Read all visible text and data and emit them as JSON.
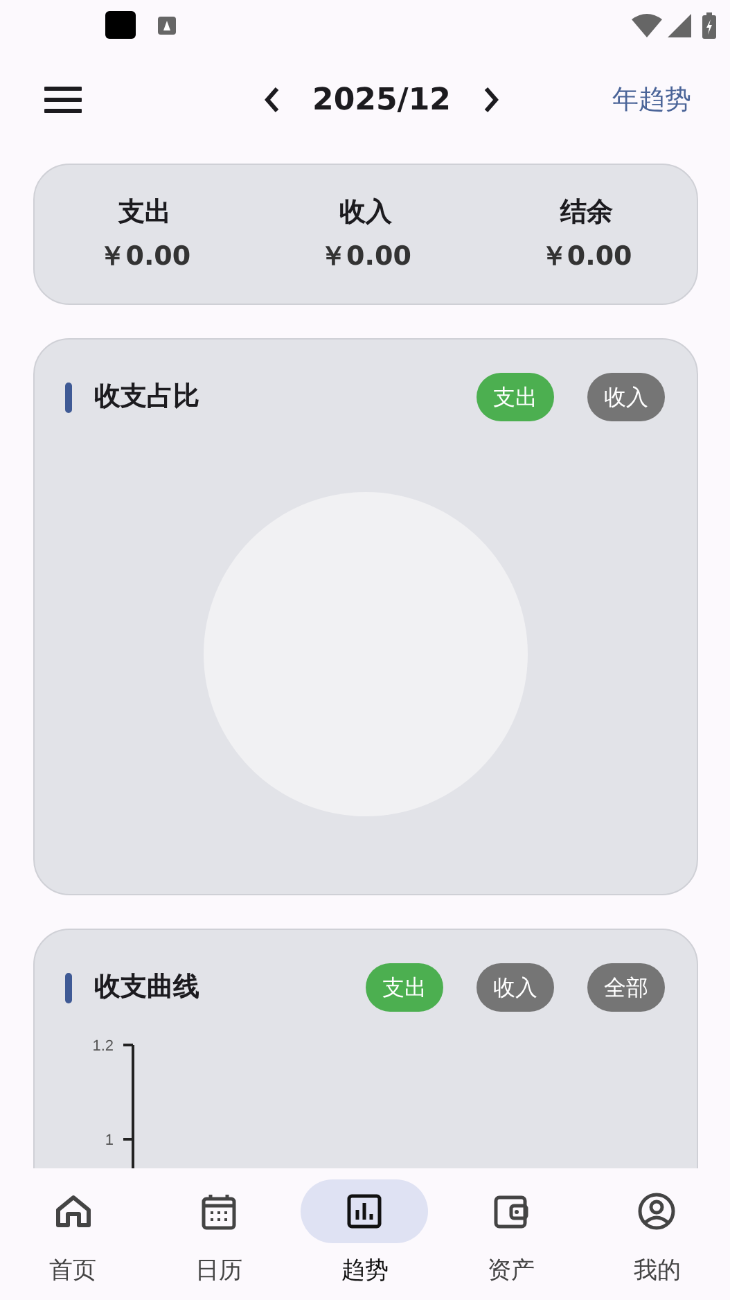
{
  "header": {
    "period": "2025/12",
    "trend_link": "年趋势"
  },
  "summary": [
    {
      "label": "支出",
      "value": "￥0.00"
    },
    {
      "label": "收入",
      "value": "￥0.00"
    },
    {
      "label": "结余",
      "value": "￥0.00"
    }
  ],
  "ratio_panel": {
    "title": "收支占比",
    "toggles": [
      {
        "label": "支出",
        "selected": true
      },
      {
        "label": "收入",
        "selected": false
      }
    ]
  },
  "curve_panel": {
    "title": "收支曲线",
    "toggles": [
      {
        "label": "支出",
        "selected": true
      },
      {
        "label": "收入",
        "selected": false
      },
      {
        "label": "全部",
        "selected": false
      }
    ],
    "y_axis_labels": [
      "1.2",
      "1"
    ]
  },
  "bottom_nav": [
    {
      "label": "首页",
      "selected": false
    },
    {
      "label": "日历",
      "selected": false
    },
    {
      "label": "趋势",
      "selected": true
    },
    {
      "label": "资产",
      "selected": false
    },
    {
      "label": "我的",
      "selected": false
    }
  ]
}
